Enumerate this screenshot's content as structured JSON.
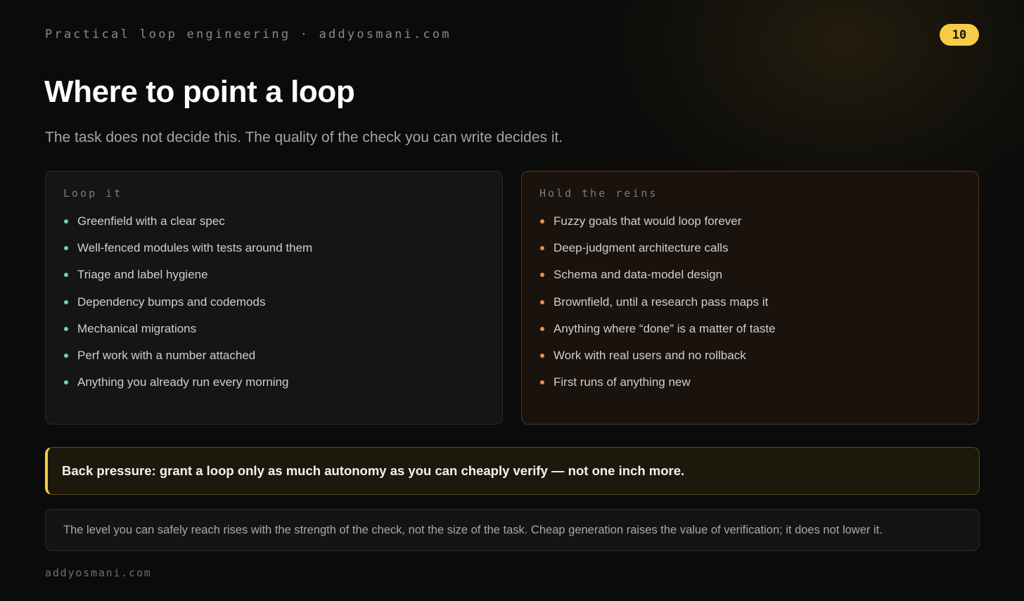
{
  "header": {
    "kicker": "Practical loop engineering · addyosmani.com",
    "page_number": "10"
  },
  "title": "Where to point a loop",
  "subtitle": "The task does not decide this. The quality of the check you can write decides it.",
  "loop_card": {
    "label": "Loop it",
    "items": [
      "Greenfield with a clear spec",
      "Well-fenced modules with tests around them",
      "Triage and label hygiene",
      "Dependency bumps and codemods",
      "Mechanical migrations",
      "Perf work with a number attached",
      "Anything you already run every morning"
    ]
  },
  "hold_card": {
    "label": "Hold the reins",
    "items": [
      "Fuzzy goals that would loop forever",
      "Deep-judgment architecture calls",
      "Schema and data-model design",
      "Brownfield, until a research pass maps it",
      "Anything where “done” is a matter of taste",
      "Work with real users and no rollback",
      "First runs of anything new"
    ]
  },
  "callout": "Back pressure: grant a loop only as much autonomy as you can cheaply verify — not one inch more.",
  "note": "The level you can safely reach rises with the strength of the check, not the size of the task. Cheap generation raises the value of verification; it does not lower it.",
  "footer": "addyosmani.com",
  "colors": {
    "accent": "#f5cc45",
    "loop_bullet": "#6fd69a",
    "hold_bullet": "#f08a55"
  }
}
